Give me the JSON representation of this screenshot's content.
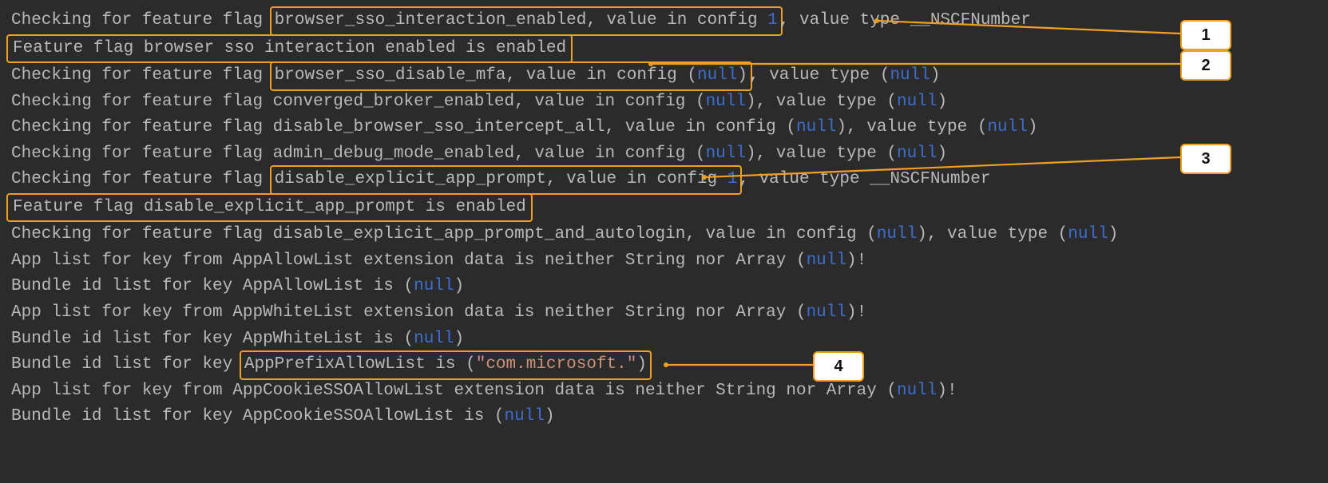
{
  "callouts": {
    "c1": "1",
    "c2": "2",
    "c3": "3",
    "c4": "4"
  },
  "t": {
    "chk": "Checking for feature flag ",
    "vcfg": ", value in config ",
    "vtyp": ", value type ",
    "NSCF": "__NSCFNumber",
    "nullw": "null",
    "one": "1",
    "ff_b_sso_int": "browser_sso_interaction_enabled",
    "ff_b_sso_mfa": "browser_sso_disable_mfa",
    "ff_conv": "converged_broker_enabled",
    "ff_dis_int": "disable_browser_sso_intercept_all",
    "ff_admin": "admin_debug_mode_enabled",
    "ff_dis_exp": "disable_explicit_app_prompt",
    "ff_dis_exp_al": "disable_explicit_app_prompt_and_autologin",
    "line2_full": "Feature flag browser sso interaction enabled is enabled",
    "line8_full": "Feature flag disable_explicit_app_prompt is enabled",
    "app_prefix_a": "App list for key from ",
    "app_prefix_b": " extension data is neither String nor Array (",
    "bundle_a": "Bundle id list for key ",
    "bundle_is": " is (",
    "kAllow": "AppAllowList",
    "kWhite": "AppWhiteList",
    "kPrefix": "AppPrefixAllowList",
    "kCookie": "AppCookieSSOAllowList",
    "ms_str": "\"com.microsoft.\"",
    "box14_inner": "AppPrefixAllowList is (\"com.microsoft.\")",
    "rparen_bang": ")!",
    "rparen": ")"
  }
}
